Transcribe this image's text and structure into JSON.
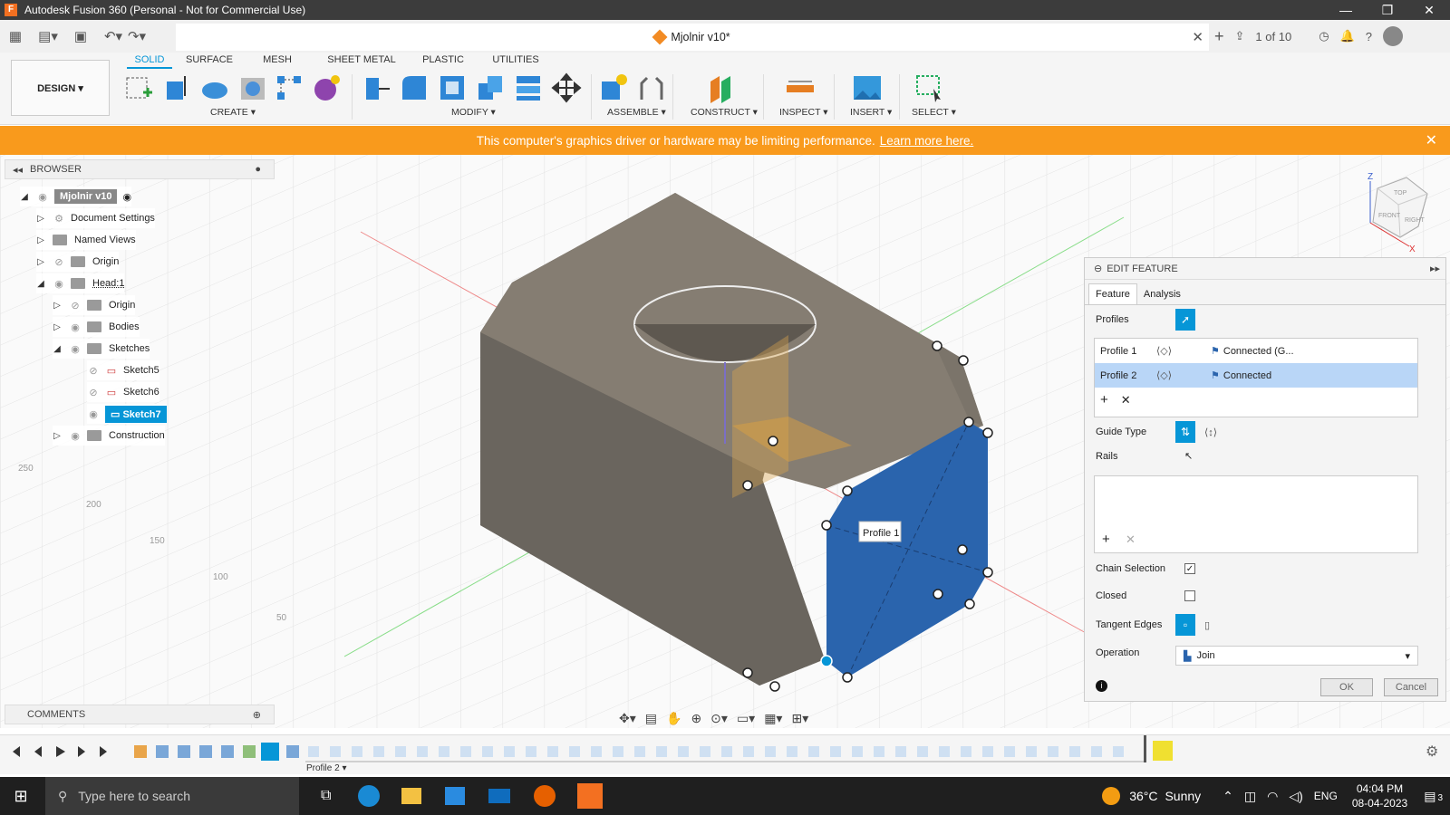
{
  "title_bar": {
    "title": "Autodesk Fusion 360 (Personal - Not for Commercial Use)"
  },
  "doc": {
    "name": "Mjolnir v10*",
    "version_count": "1 of 10"
  },
  "ribbon": {
    "design": "DESIGN ▾",
    "tabs": [
      "SOLID",
      "SURFACE",
      "MESH",
      "SHEET METAL",
      "PLASTIC",
      "UTILITIES"
    ],
    "groups": [
      "CREATE ▾",
      "MODIFY ▾",
      "ASSEMBLE ▾",
      "CONSTRUCT ▾",
      "INSPECT ▾",
      "INSERT ▾",
      "SELECT ▾"
    ]
  },
  "banner": {
    "text": "This computer's graphics driver or hardware may be limiting performance.",
    "link": "Learn more here."
  },
  "browser": {
    "title": "BROWSER",
    "root": "Mjolnir v10",
    "items": [
      "Document Settings",
      "Named Views",
      "Origin",
      "Head:1",
      "Origin",
      "Bodies",
      "Sketches",
      "Sketch5",
      "Sketch6",
      "Sketch7",
      "Construction"
    ]
  },
  "comments": {
    "title": "COMMENTS"
  },
  "viewcube": {
    "top": "TOP",
    "front": "FRONT",
    "right": "RIGHT",
    "z": "Z",
    "x": "X"
  },
  "viewport": {
    "tooltip": "Profile 1",
    "scale": [
      "250",
      "200",
      "150",
      "100",
      "50"
    ]
  },
  "edit_feature": {
    "title": "EDIT FEATURE",
    "tabs": [
      "Feature",
      "Analysis"
    ],
    "profiles_label": "Profiles",
    "profiles": [
      {
        "name": "Profile 1",
        "status": "Connected (G..."
      },
      {
        "name": "Profile 2",
        "status": "Connected"
      }
    ],
    "guide_type": "Guide Type",
    "rails": "Rails",
    "chain_selection": "Chain Selection",
    "closed": "Closed",
    "tangent_edges": "Tangent Edges",
    "operation_label": "Operation",
    "operation_value": "Join",
    "ok": "OK",
    "cancel": "Cancel"
  },
  "timeline": {
    "label": "Profile 2 ▾"
  },
  "taskbar": {
    "search": "Type here to search",
    "weather_temp": "36°C",
    "weather": "Sunny",
    "lang": "ENG",
    "time": "04:04 PM",
    "date": "08-04-2023",
    "notif": "3"
  }
}
